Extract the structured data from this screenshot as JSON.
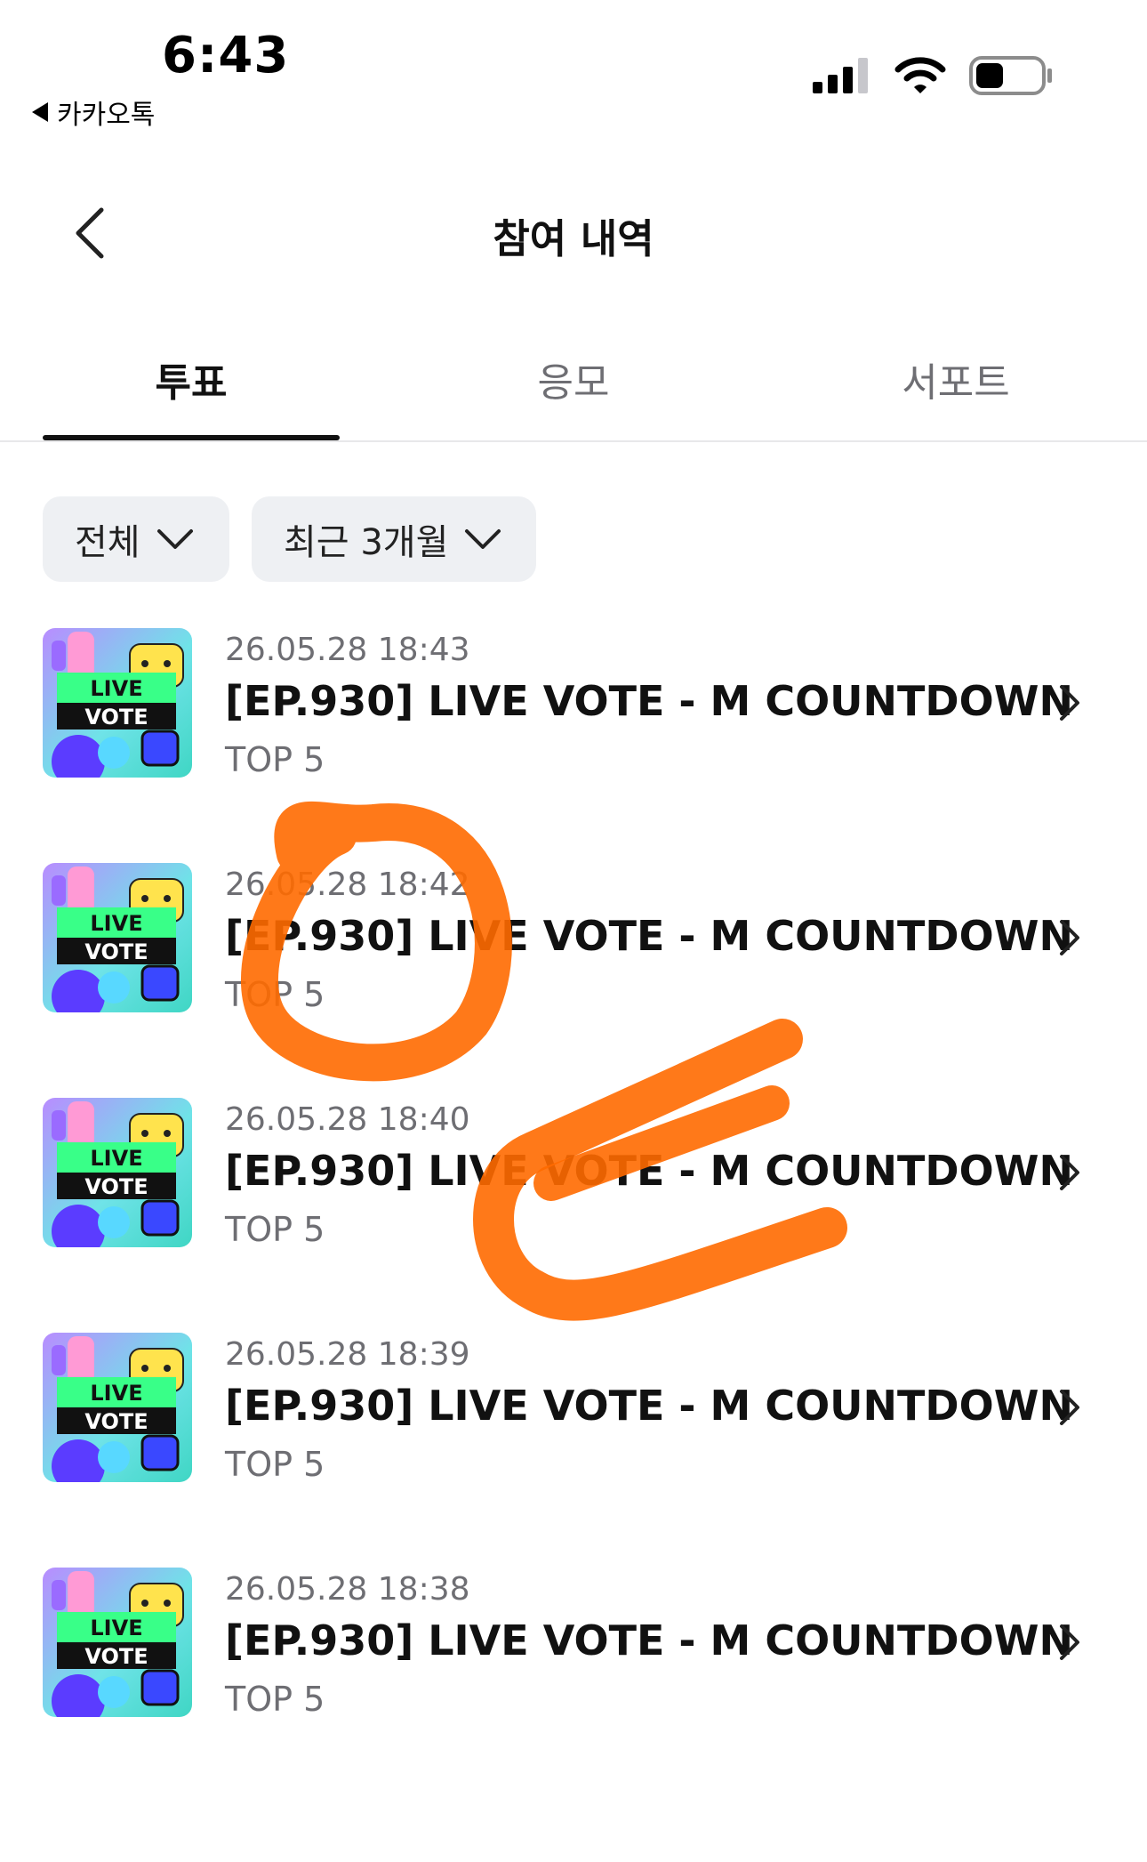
{
  "status_bar": {
    "time": "6:43",
    "back_app_label": "카카오톡",
    "icons": [
      "cellular-signal-icon",
      "wifi-icon",
      "battery-icon"
    ]
  },
  "header": {
    "title": "참여 내역",
    "back_icon": "chevron-left-icon"
  },
  "tabs": [
    {
      "label": "투표",
      "active": true
    },
    {
      "label": "응모",
      "active": false
    },
    {
      "label": "서포트",
      "active": false
    }
  ],
  "filters": [
    {
      "label": "전체",
      "icon": "chevron-down-icon"
    },
    {
      "label": "최근 3개월",
      "icon": "chevron-down-icon"
    }
  ],
  "items": [
    {
      "date": "26.05.28 18:43",
      "title": "[EP.930] LIVE VOTE - M COUNTDOWN",
      "subtitle": "TOP 5",
      "thumb_text": [
        "LIVE",
        "VOTE"
      ]
    },
    {
      "date": "26.05.28 18:42",
      "title": "[EP.930] LIVE VOTE - M COUNTDOWN",
      "subtitle": "TOP 5",
      "thumb_text": [
        "LIVE",
        "VOTE"
      ]
    },
    {
      "date": "26.05.28 18:40",
      "title": "[EP.930] LIVE VOTE - M COUNTDOWN",
      "subtitle": "TOP 5",
      "thumb_text": [
        "LIVE",
        "VOTE"
      ]
    },
    {
      "date": "26.05.28 18:39",
      "title": "[EP.930] LIVE VOTE - M COUNTDOWN",
      "subtitle": "TOP 5",
      "thumb_text": [
        "LIVE",
        "VOTE"
      ]
    },
    {
      "date": "26.05.28 18:38",
      "title": "[EP.930] LIVE VOTE - M COUNTDOWN",
      "subtitle": "TOP 5",
      "thumb_text": [
        "LIVE",
        "VOTE"
      ]
    }
  ],
  "colors": {
    "text_primary": "#111111",
    "text_secondary": "#6e6e73",
    "filter_bg": "#eef0f3",
    "annotation": "#ff6a00"
  }
}
